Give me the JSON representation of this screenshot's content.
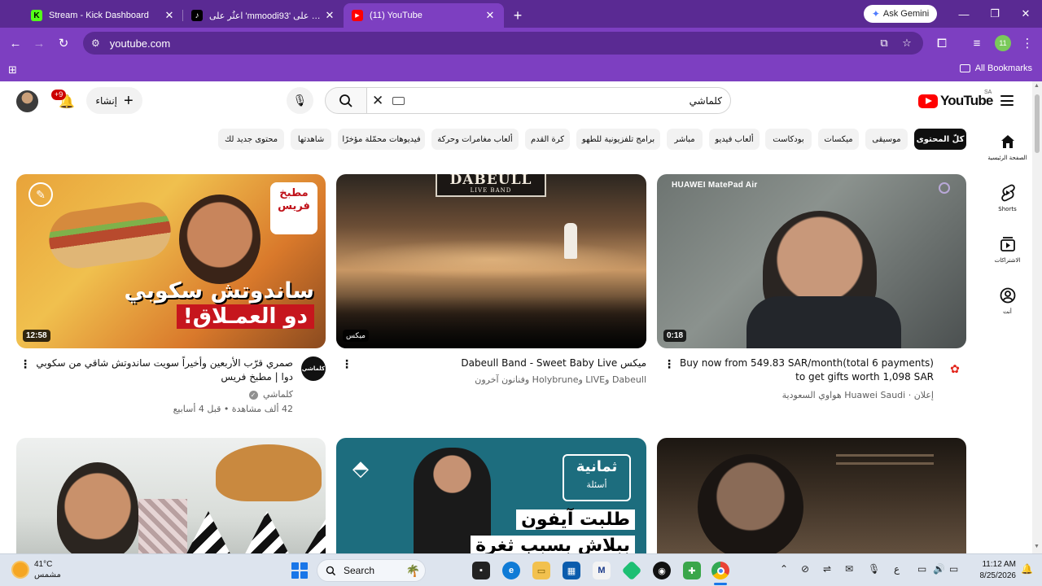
{
  "browser": {
    "tabs": [
      {
        "title": "Stream - Kick Dashboard",
        "favicon": "kick-icon",
        "active": false
      },
      {
        "title": "‫TikTok على 'mmoodi93' اعثُر على‬",
        "favicon": "tiktok-icon",
        "active": false
      },
      {
        "title": "(11) YouTube",
        "favicon": "youtube-icon",
        "active": true
      }
    ],
    "new_tab_label": "+",
    "gemini_label": "Ask Gemini",
    "address": "youtube.com",
    "profile_badge": "11",
    "all_bookmarks_label": "All Bookmarks",
    "accent": "#7d3fc1"
  },
  "youtube": {
    "logo_text": "YouTube",
    "country_code": "SA",
    "search_query": "كلماشي",
    "create_label": "إنشاء",
    "notifications_badge": "+9",
    "chips": [
      "كلّ المحتوى",
      "موسيقى",
      "ميكسات",
      "بودكاست",
      "ألعاب فيديو",
      "مباشر",
      "برامج تلفزيونية للطهو",
      "كرة القدم",
      "ألعاب مغامرات وحركة",
      "فيديوهات محمّلة مؤخرًا",
      "شاهدتها",
      "محتوى جديد لك"
    ],
    "side_nav": [
      {
        "label": "الصفحة الرئيسية",
        "icon": "home-icon"
      },
      {
        "label": "Shorts",
        "icon": "shorts-icon"
      },
      {
        "label": "الاشتراكات",
        "icon": "subscriptions-icon"
      },
      {
        "label": "أنت",
        "icon": "you-icon"
      }
    ],
    "videos": [
      {
        "title": "ميكس Dabeull Band - Sweet Baby Live",
        "meta1": "Dabeull وLIVE وHolybrune وفنانون آخرون",
        "meta2": "",
        "overlay": "ميكس",
        "thumb_text": "DABEULL",
        "thumb_sub": "LIVE BAND"
      },
      {
        "title": "Buy now from 549.83 SAR/month(total 6 payments) to get gifts worth 1,098 SAR",
        "meta1": "إعلان · Huawei Saudi هواوي السعودية",
        "meta2": "",
        "duration": "0:18",
        "thumb_text": "HUAWEI MatePad Air"
      },
      {
        "title": "صمري قرّب الأربعين وأخيراً سويت ساندوتش شاقي من سكوبي دوا | مطبخ فريس",
        "channel": "كلماشي",
        "meta2": "42 ألف مشاهدة • قبل 4 أسابيع",
        "duration": "12:58",
        "thumb_text_1": "ساندوتش سكوبي",
        "thumb_text_2": "دو العمـلاق!",
        "thumb_badge": "مطبخ فريس",
        "channel_avatar": "كلماشي"
      },
      {
        "thumb_text": ""
      },
      {
        "thumb_text_1": "ثمانية",
        "thumb_text_2": "أسئلة",
        "thumb_text_3": "طلبت آيفون",
        "thumb_text_4": "ببلاش بسبب ثغرة"
      },
      {
        "thumb_text": ""
      }
    ]
  },
  "taskbar": {
    "temperature": "41°C",
    "weather_desc": "مشمس",
    "search_label": "Search",
    "time": "11:12 AM",
    "date": "8/25/2026",
    "lang": "ع"
  }
}
